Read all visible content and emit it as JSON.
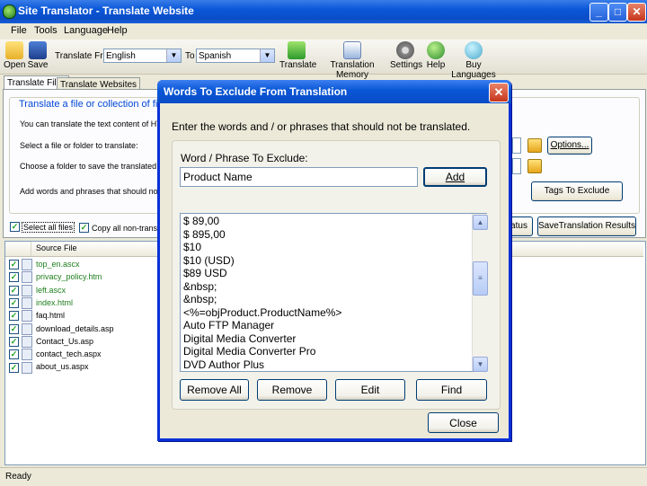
{
  "window": {
    "title": "Site Translator - Translate Website"
  },
  "menu": [
    "File",
    "Tools",
    "Language",
    "Help"
  ],
  "toolbar": {
    "open": "Open",
    "save": "Save",
    "translate_from_label": "Translate From",
    "from_value": "English",
    "to_label": "To",
    "to_value": "Spanish",
    "translate": "Translate",
    "translation_memory": "Translation Memory",
    "settings": "Settings",
    "help": "Help",
    "buy_languages": "Buy Languages"
  },
  "tabs": [
    "Translate Files",
    "Translate Websites"
  ],
  "panel": {
    "group_title": "Translate a file or collection of files",
    "line1": "You can translate the text content of HTM, H",
    "line2": "Select a file or folder to translate:",
    "line3": "Choose a folder to save the translated files in",
    "line4": "Add words and phrases that should not be tra",
    "options_button": "Options...",
    "tags_button": "Tags To Exclude",
    "status_button": "atus",
    "save_results_button": "SaveTranslation Results",
    "select_all": "Select all files",
    "copy_all": "Copy all non-transl"
  },
  "file_list": {
    "header": "Source File",
    "files": [
      {
        "name": "top_en.ascx",
        "color": "#1e7f1e"
      },
      {
        "name": "privacy_policy.htm",
        "color": "#1e7f1e"
      },
      {
        "name": "left.ascx",
        "color": "#1e7f1e"
      },
      {
        "name": "index.html",
        "color": "#1e7f1e"
      },
      {
        "name": "faq.html",
        "color": "#000000"
      },
      {
        "name": "download_details.asp",
        "color": "#000000"
      },
      {
        "name": "Contact_Us.asp",
        "color": "#000000"
      },
      {
        "name": "contact_tech.aspx",
        "color": "#000000"
      },
      {
        "name": "about_us.aspx",
        "color": "#000000"
      }
    ]
  },
  "status": "Ready",
  "dialog": {
    "title": "Words To Exclude From Translation",
    "instruction": "Enter the words and / or phrases that should not be translated.",
    "field_label": "Word / Phrase To Exclude:",
    "field_value": "Product Name",
    "add": "Add",
    "items": [
      "$ 89,00",
      "$ 895,00",
      "$10",
      "$10 (USD)",
      "$89 USD",
      "&nbsp;",
      "&nbsp;",
      "<%=objProduct.ProductName%>",
      "Auto FTP Manager",
      "Digital Media Converter",
      "Digital Media Converter Pro",
      "DVD Author Plus"
    ],
    "remove_all": "Remove All",
    "remove": "Remove",
    "edit": "Edit",
    "find": "Find",
    "close": "Close"
  }
}
